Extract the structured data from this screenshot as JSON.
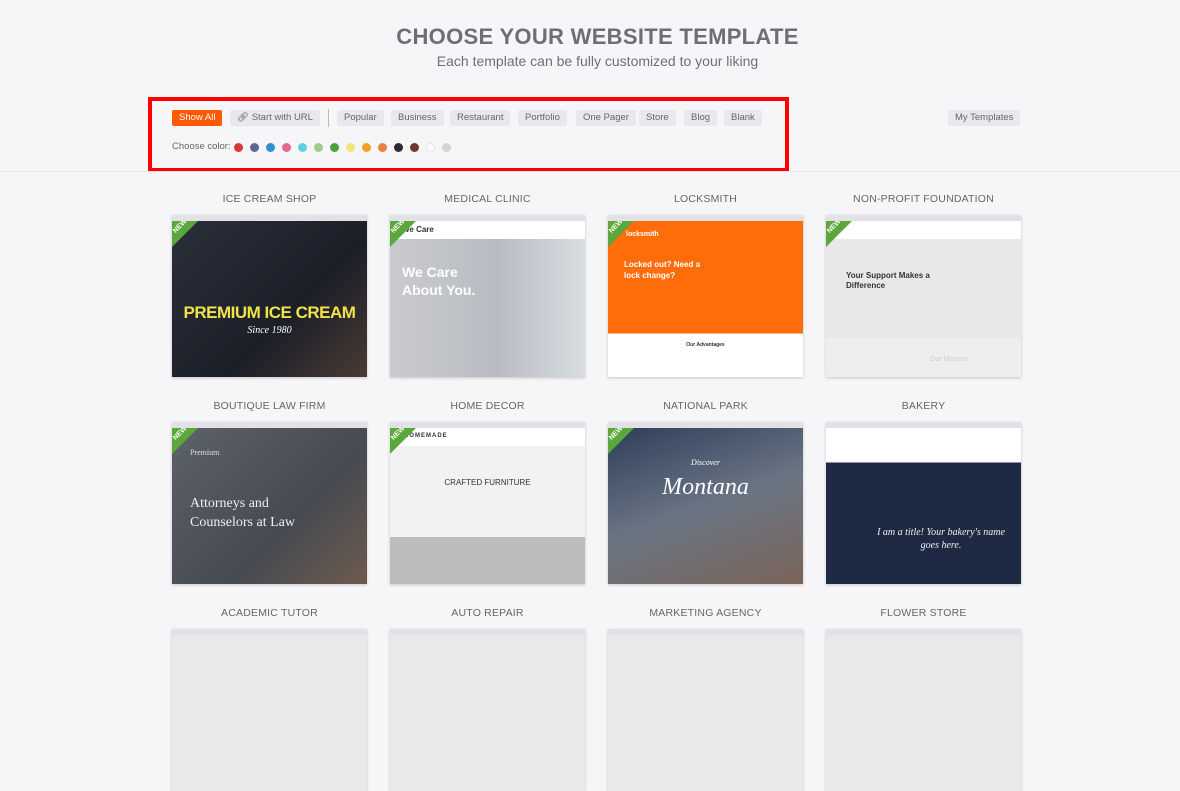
{
  "header": {
    "title": "CHOOSE YOUR WEBSITE TEMPLATE",
    "subtitle": "Each template can be fully customized to your liking"
  },
  "filters": {
    "show_all": "Show All",
    "start_with_url": "Start with URL",
    "categories": [
      "Popular",
      "Business",
      "Restaurant",
      "Portfolio",
      "One Pager",
      "Store",
      "Blog",
      "Blank"
    ],
    "my_templates": "My Templates",
    "active": "Show All"
  },
  "colors": {
    "label": "Choose color:",
    "swatches": [
      "#d9383a",
      "#5a6a95",
      "#2f8fd0",
      "#e06a8a",
      "#5fd0dc",
      "#9ccf86",
      "#4aa23a",
      "#f0e57a",
      "#f2a020",
      "#e8843f",
      "#2b2b30",
      "#6b3a2a",
      "#ffffff",
      "#d4d4d6"
    ]
  },
  "ribbon_label": "NEW",
  "templates": [
    {
      "name": "ICE CREAM SHOP",
      "new": true,
      "hero": "PREMIUM ICE CREAM",
      "sub": "Since 1980"
    },
    {
      "name": "MEDICAL CLINIC",
      "new": true,
      "hero": "We Care About You.",
      "brand": "We Care"
    },
    {
      "name": "LOCKSMITH",
      "new": true,
      "hero": "Locked out? Need a lock change?",
      "brand": "locksmith",
      "section": "Our Advantages"
    },
    {
      "name": "NON-PROFIT FOUNDATION",
      "new": true,
      "hero": "Your Support Makes a Difference",
      "section": "Our Mission"
    },
    {
      "name": "BOUTIQUE LAW FIRM",
      "new": true,
      "hero": "Attorneys and Counselors at Law",
      "brand": "Premium"
    },
    {
      "name": "HOME DECOR",
      "new": true,
      "hero": "CRAFTED FURNITURE",
      "brand": "HOMEMADE"
    },
    {
      "name": "NATIONAL PARK",
      "new": true,
      "hero": "Montana",
      "sub": "Discover"
    },
    {
      "name": "BAKERY",
      "new": false,
      "hero": "I am a title! Your bakery's name goes here."
    },
    {
      "name": "ACADEMIC TUTOR"
    },
    {
      "name": "AUTO REPAIR"
    },
    {
      "name": "MARKETING AGENCY"
    },
    {
      "name": "FLOWER STORE"
    }
  ]
}
